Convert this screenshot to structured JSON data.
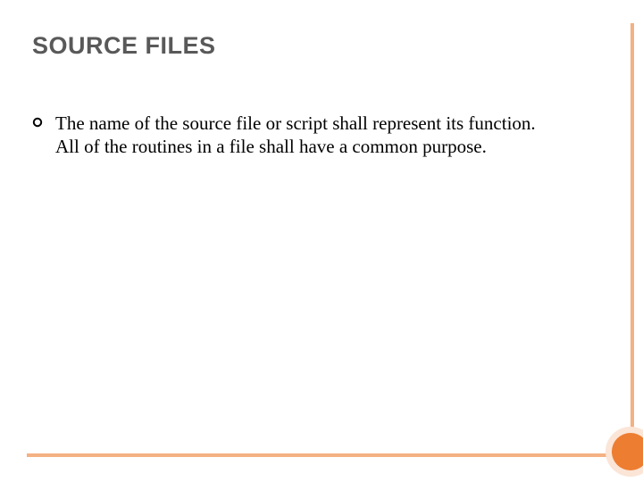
{
  "slide": {
    "title": "SOURCE FILES",
    "bullets": [
      {
        "text": "The name of the source file or script shall represent its function. All of the routines in a file shall have a common purpose."
      }
    ]
  },
  "theme": {
    "accent": "#f4b183",
    "accentDark": "#ed7d31",
    "accentLight": "#fbe5d6",
    "titleColor": "#595959"
  }
}
